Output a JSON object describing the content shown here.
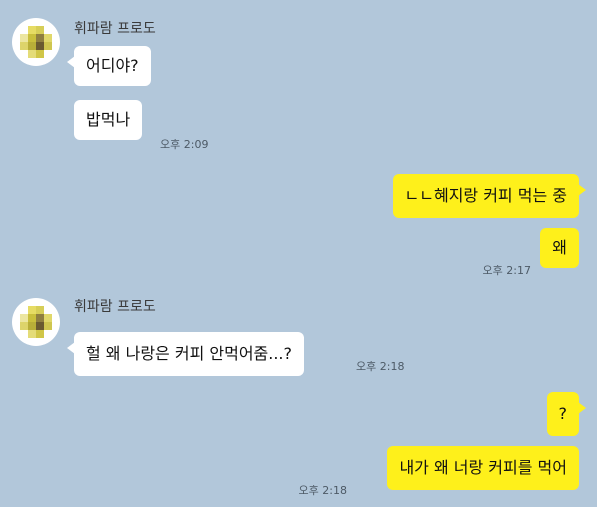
{
  "chat": {
    "messages": [
      {
        "sender": "휘파람 프로도",
        "text": "어디야?"
      },
      {
        "text": "밥먹나",
        "time": "오후 2:09"
      },
      {
        "text": "ㄴㄴ혜지랑 커피 먹는 중"
      },
      {
        "text": "왜",
        "time": "오후 2:17"
      },
      {
        "sender": "휘파람 프로도",
        "text": "헐 왜 나랑은 커피 안먹어줌...?",
        "time": "오후 2:18"
      },
      {
        "text": "?"
      },
      {
        "text": "내가 왜 너랑 커피를 먹어",
        "time": "오후 2:18"
      }
    ]
  },
  "colors": {
    "background": "#b2c7da",
    "incoming_bubble": "#ffffff",
    "outgoing_bubble": "#fef01b",
    "avatar_blur": "#d8d25a"
  },
  "icons": {
    "avatar": "profile-photo-blurred"
  }
}
